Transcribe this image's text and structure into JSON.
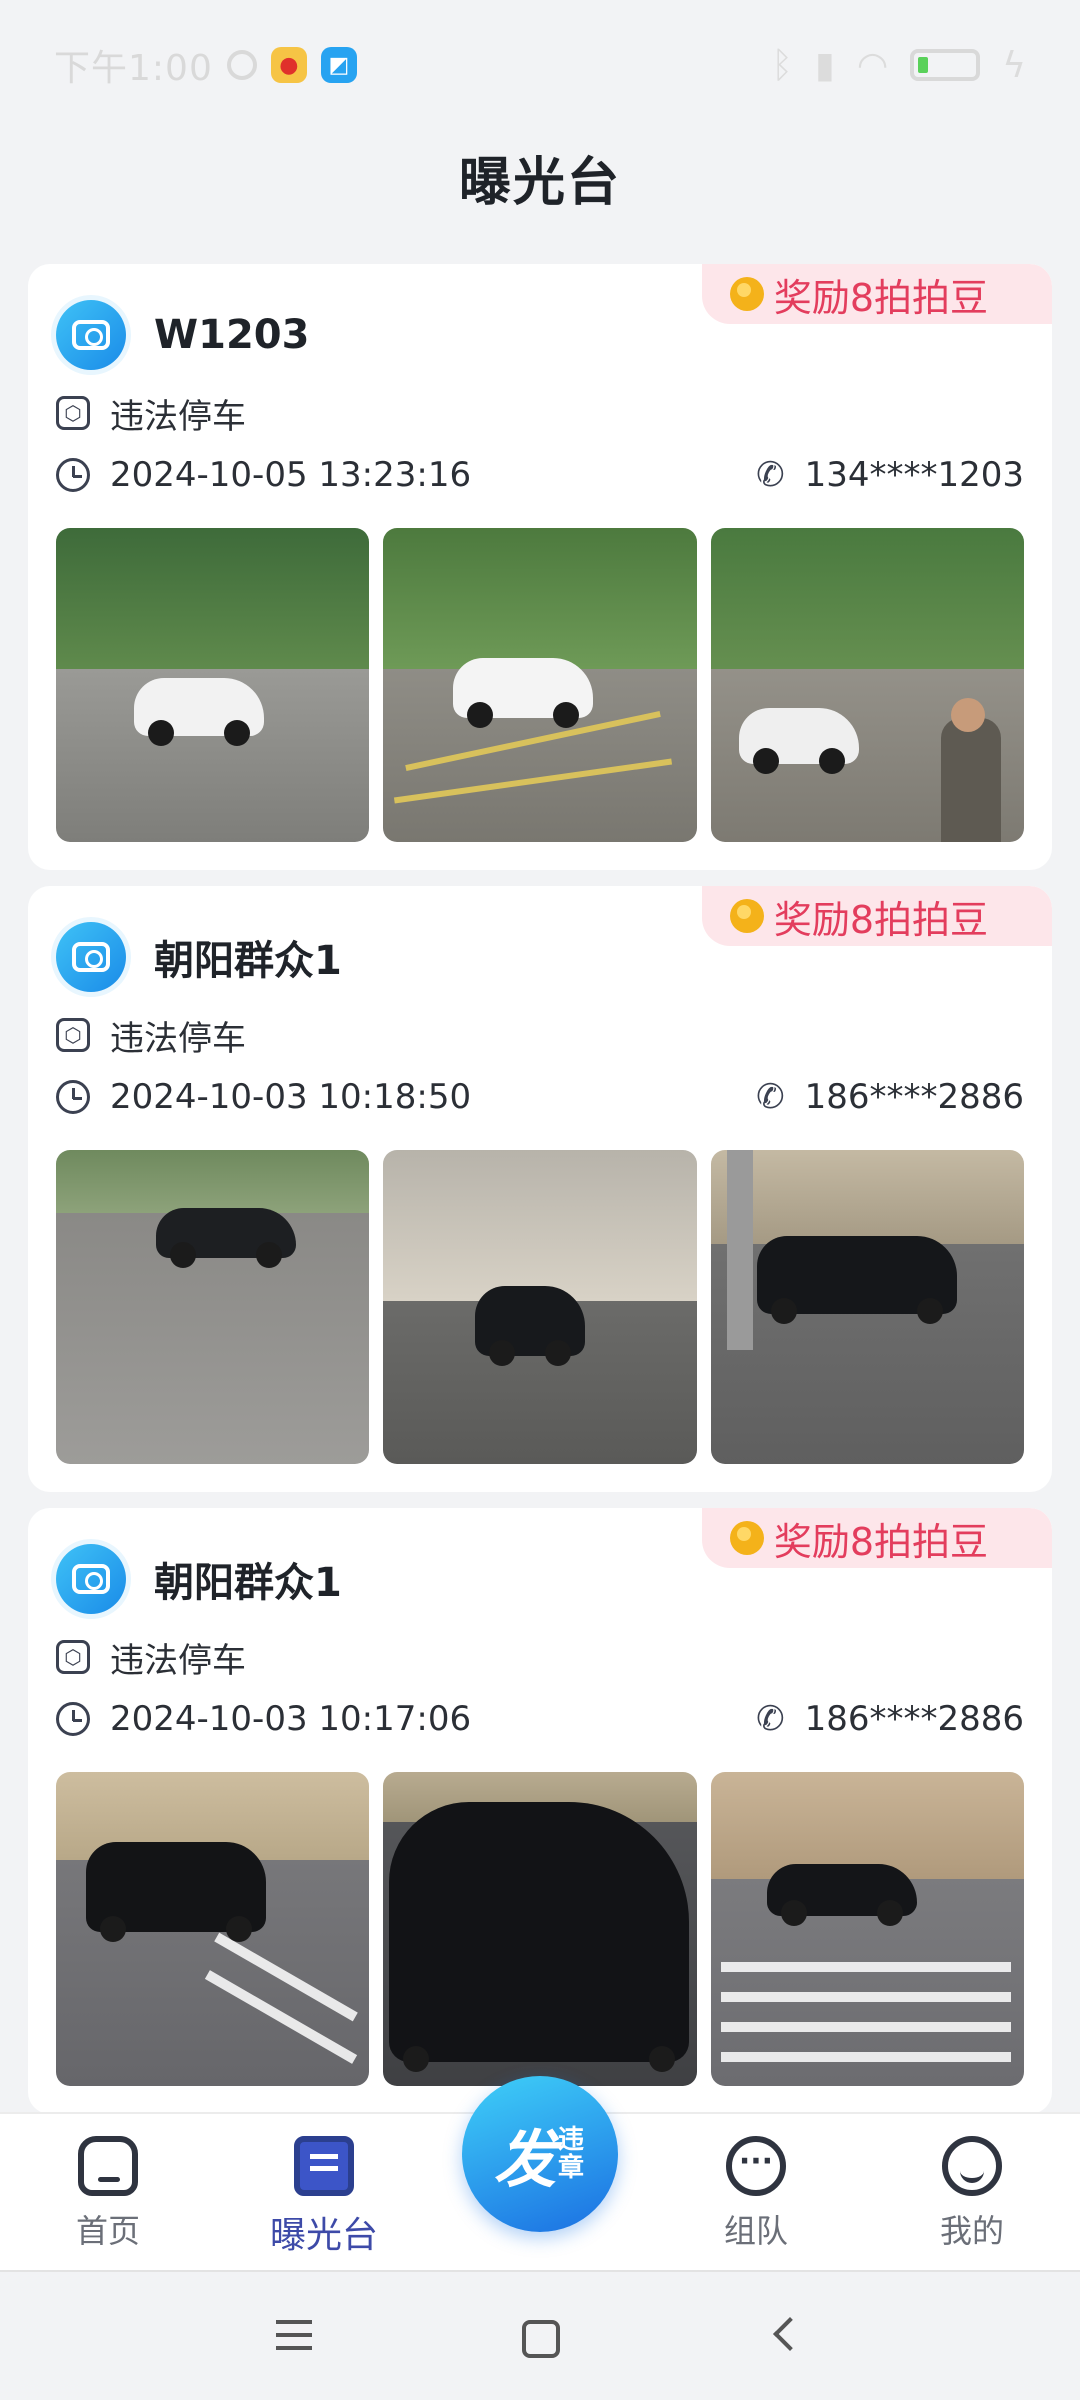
{
  "status_bar": {
    "time": "下午1:00"
  },
  "page": {
    "title": "曝光台"
  },
  "reports": [
    {
      "reward": "奖励8拍拍豆",
      "user": "W1203",
      "violation": "违法停车",
      "time": "2024-10-05 13:23:16",
      "phone": "134****1203"
    },
    {
      "reward": "奖励8拍拍豆",
      "user": "朝阳群众1",
      "violation": "违法停车",
      "time": "2024-10-03 10:18:50",
      "phone": "186****2886"
    },
    {
      "reward": "奖励8拍拍豆",
      "user": "朝阳群众1",
      "violation": "违法停车",
      "time": "2024-10-03 10:17:06",
      "phone": "186****2886"
    }
  ],
  "tabbar": {
    "home": "首页",
    "exposure": "曝光台",
    "fab_big": "发",
    "fab_small": "违章",
    "team": "组队",
    "mine": "我的"
  },
  "colors": {
    "accent": "#3d4aa8",
    "reward_bg": "#fde6ea",
    "reward_text": "#e33d5d",
    "fab": "#1b6fe2"
  }
}
